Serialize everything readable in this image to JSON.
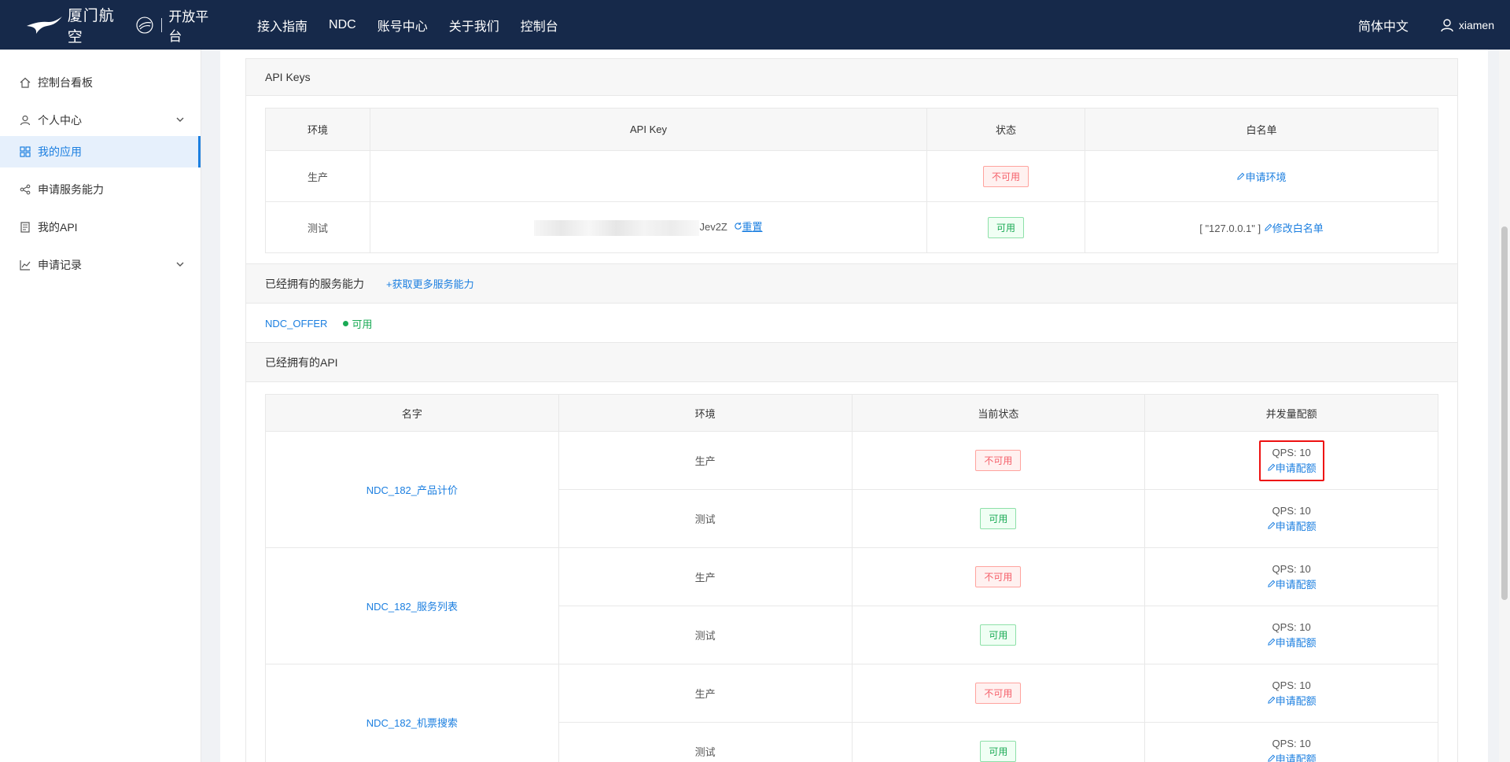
{
  "header": {
    "logo_text": "厦门航空",
    "logo_platform": "开放平台",
    "nav": [
      "接入指南",
      "NDC",
      "账号中心",
      "关于我们",
      "控制台"
    ],
    "language": "简体中文",
    "username": "xiamen"
  },
  "sidebar": {
    "items": [
      {
        "label": "控制台看板",
        "icon": "home-icon"
      },
      {
        "label": "个人中心",
        "icon": "user-icon",
        "expandable": true
      },
      {
        "label": "我的应用",
        "icon": "apps-icon",
        "active": true
      },
      {
        "label": "申请服务能力",
        "icon": "share-icon"
      },
      {
        "label": "我的API",
        "icon": "doc-icon"
      },
      {
        "label": "申请记录",
        "icon": "chart-icon",
        "expandable": true
      }
    ]
  },
  "api_keys": {
    "title": "API Keys",
    "columns": [
      "环境",
      "API Key",
      "状态",
      "白名单"
    ],
    "rows": [
      {
        "env": "生产",
        "key_suffix": "",
        "status": "不可用",
        "whitelist_value": "",
        "action": "申请环境"
      },
      {
        "env": "测试",
        "key_suffix": "Jev2Z",
        "reset": "重置",
        "status": "可用",
        "whitelist_value": "[ \"127.0.0.1\" ]",
        "action": "修改白名单"
      }
    ]
  },
  "services": {
    "title": "已经拥有的服务能力",
    "add_link": "获取更多服务能力",
    "items": [
      {
        "name": "NDC_OFFER",
        "status": "可用"
      }
    ]
  },
  "apis": {
    "title": "已经拥有的API",
    "columns": [
      "名字",
      "环境",
      "当前状态",
      "并发量配额"
    ],
    "groups": [
      {
        "name": "NDC_182_产品计价",
        "rows": [
          {
            "env": "生产",
            "status": "不可用",
            "qps": "QPS: 10",
            "action": "申请配额"
          },
          {
            "env": "测试",
            "status": "可用",
            "qps": "QPS: 10",
            "action": "申请配额"
          }
        ]
      },
      {
        "name": "NDC_182_服务列表",
        "rows": [
          {
            "env": "生产",
            "status": "不可用",
            "qps": "QPS: 10",
            "action": "申请配额"
          },
          {
            "env": "测试",
            "status": "可用",
            "qps": "QPS: 10",
            "action": "申请配额"
          }
        ]
      },
      {
        "name": "NDC_182_机票搜索",
        "rows": [
          {
            "env": "生产",
            "status": "不可用",
            "qps": "QPS: 10",
            "action": "申请配额"
          },
          {
            "env": "测试",
            "status": "可用",
            "qps": "QPS: 10",
            "action": "申请配额"
          }
        ]
      }
    ]
  },
  "colors": {
    "topbar": "#16294a",
    "link": "#1c7fe0",
    "ok": "#1aaa55",
    "bad": "#f5606a",
    "highlight": "#ee1111"
  }
}
